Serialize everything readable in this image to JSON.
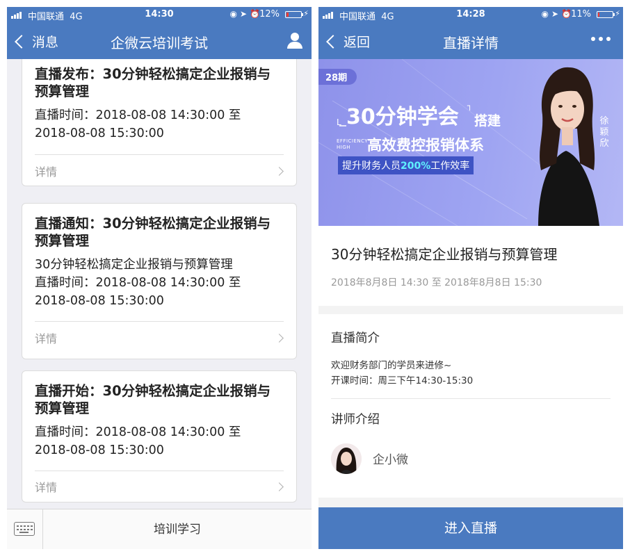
{
  "left": {
    "status": {
      "carrier": "中国联通",
      "network": "4G",
      "time": "14:30",
      "battery": "12%",
      "battery_level": 0.12
    },
    "nav": {
      "back_label": "消息",
      "title": "企微云培训考试"
    },
    "cards": [
      {
        "title": "直播发布：30分钟轻松搞定企业报销与预算管理",
        "lines": [
          "直播时间：2018-08-08 14:30:00 至",
          "2018-08-08 15:30:00"
        ],
        "detail": "详情"
      },
      {
        "title": "直播通知：30分钟轻松搞定企业报销与预算管理",
        "lines": [
          "30分钟轻松搞定企业报销与预算管理",
          "直播时间：2018-08-08 14:30:00 至",
          "2018-08-08 15:30:00"
        ],
        "detail": "详情"
      },
      {
        "title": "直播开始：30分钟轻松搞定企业报销与预算管理",
        "lines": [
          "直播时间：2018-08-08 14:30:00 至",
          "2018-08-08 15:30:00"
        ],
        "detail": "详情"
      }
    ],
    "bottom": {
      "menu_label": "培训学习"
    }
  },
  "right": {
    "status": {
      "carrier": "中国联通",
      "network": "4G",
      "time": "14:28",
      "battery": "11%",
      "battery_level": 0.11
    },
    "nav": {
      "back_label": "返回",
      "title": "直播详情"
    },
    "banner": {
      "badge": "28期",
      "main": "30分钟学会",
      "main_suffix": "搭建",
      "sub": "高效费控报销体系",
      "pill_pre": "提升财务人员",
      "pill_highlight": "200%",
      "pill_post": "工作效率",
      "efficiency": "EFFICIENCY HIGH",
      "presenter_name": "徐颖欣"
    },
    "course": {
      "title": "30分钟轻松搞定企业报销与预算管理",
      "time": "2018年8月8日 14:30 至 2018年8月8日 15:30"
    },
    "intro": {
      "heading": "直播简介",
      "line1": "欢迎财务部门的学员来进修~",
      "line2": "开课时间：周三下午14:30-15:30"
    },
    "teacher": {
      "heading": "讲师介绍",
      "name": "企小微"
    },
    "enter_label": "进入直播"
  }
}
